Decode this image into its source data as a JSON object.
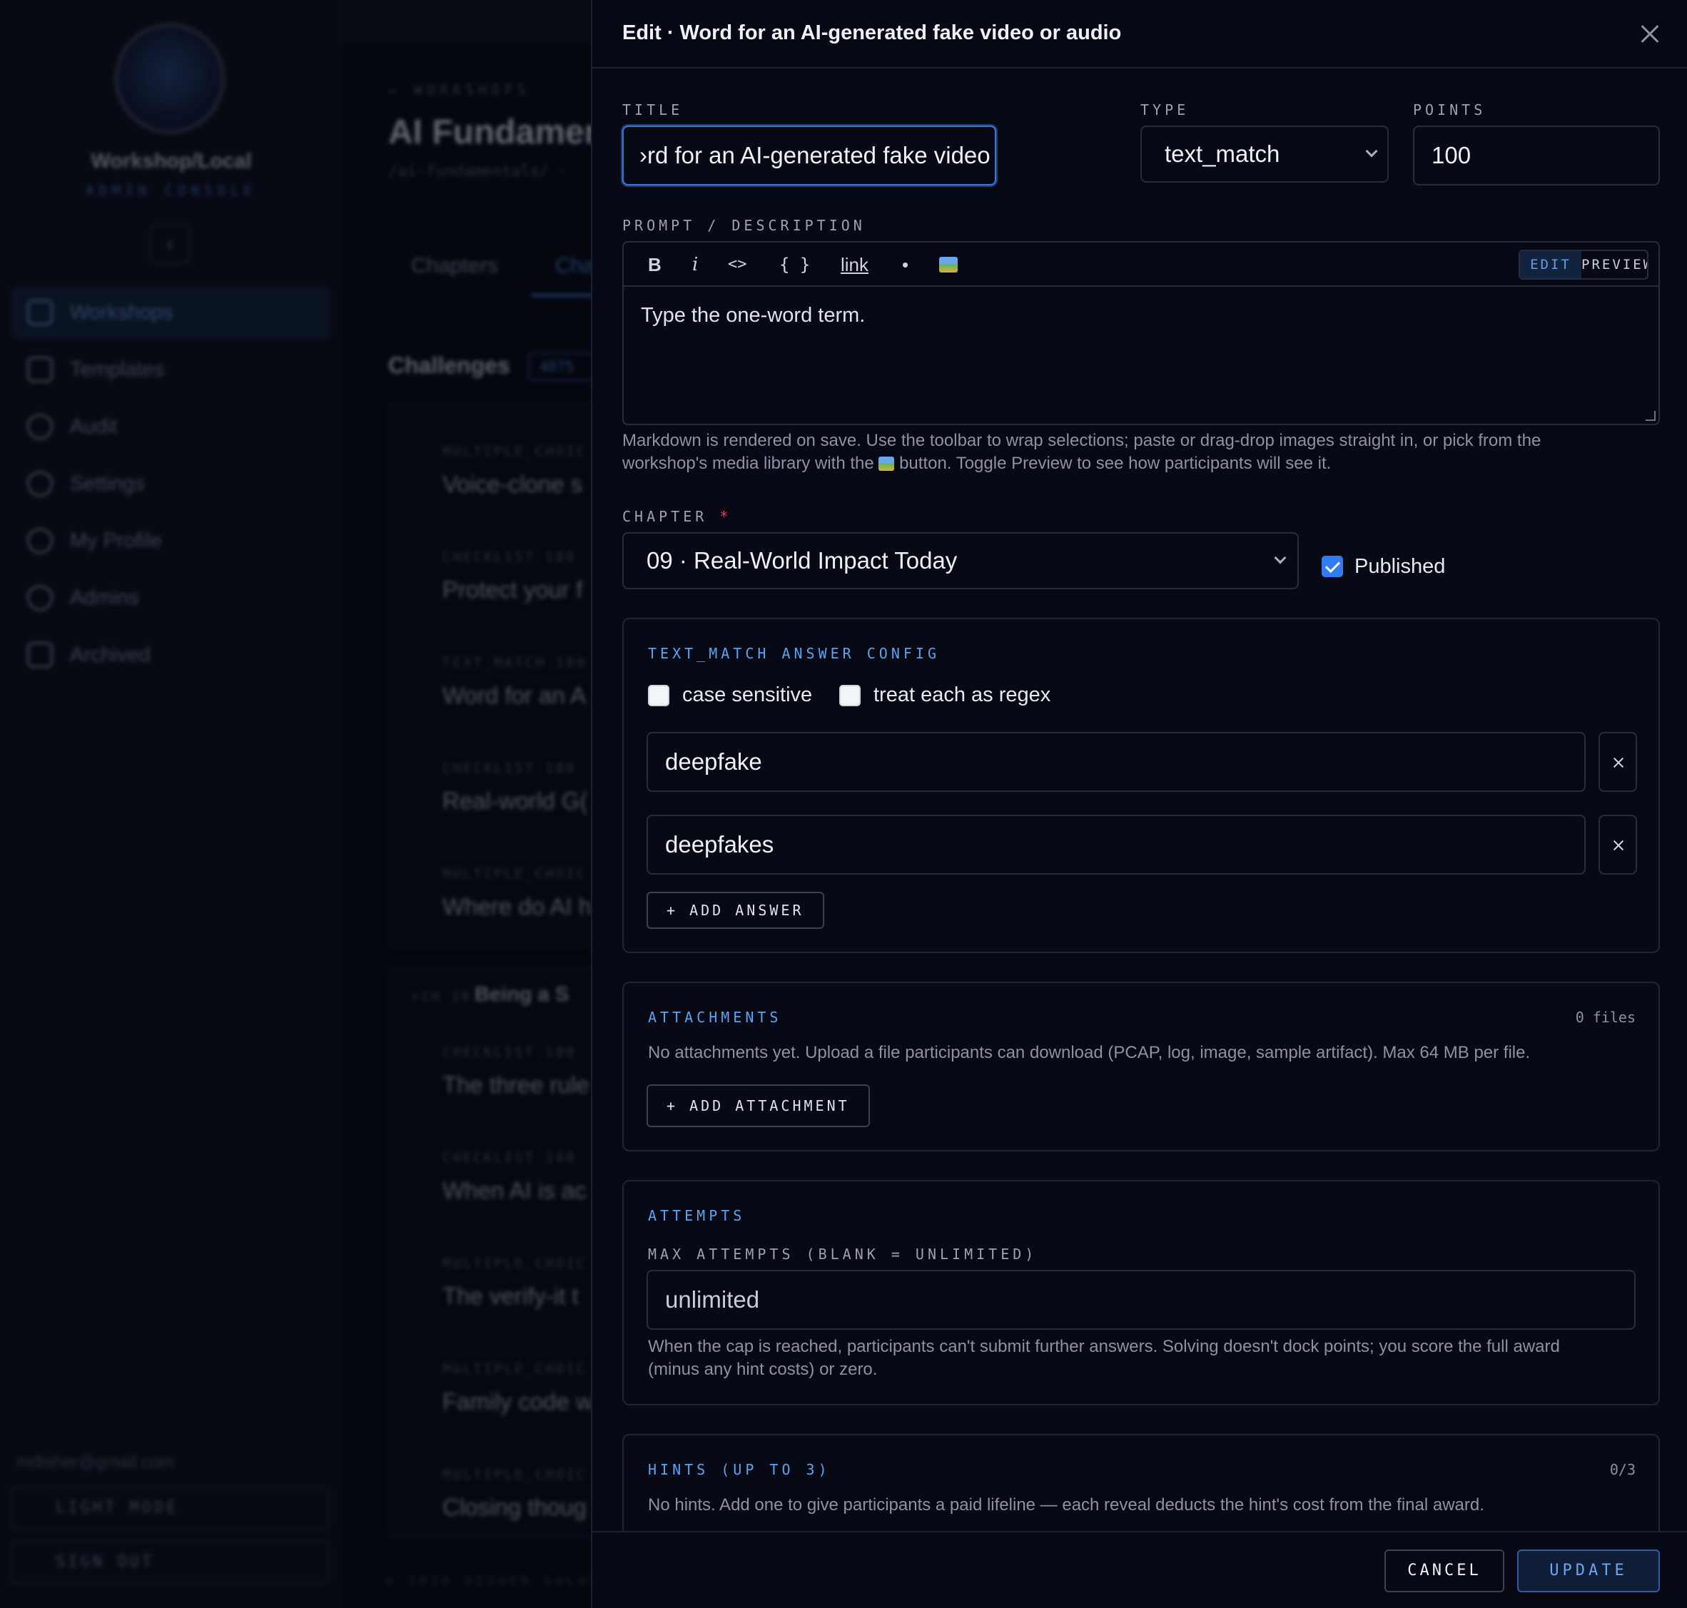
{
  "background": {
    "sidebar": {
      "brand": "Workshop/Local",
      "brand_sub": "ADMIN CONSOLE",
      "collapse_glyph": "‹",
      "nav": [
        {
          "label": "Workshops",
          "icon": "grid-icon",
          "active": true
        },
        {
          "label": "Templates",
          "icon": "layers-icon"
        },
        {
          "label": "Audit",
          "icon": "clock-icon"
        },
        {
          "label": "Settings",
          "icon": "gear-icon"
        },
        {
          "label": "My Profile",
          "icon": "gear-icon"
        },
        {
          "label": "Admins",
          "icon": "gear-icon"
        },
        {
          "label": "Archived",
          "icon": "archive-icon"
        }
      ],
      "user_email": "mdisher@gmail.com",
      "light_mode_label": "LIGHT MODE",
      "sign_out_label": "SIGN OUT"
    },
    "main": {
      "breadcrumb": "← WORKSHOPS",
      "title": "AI Fundamen",
      "path": "/ai-fundamentals/ ·",
      "tabs": [
        "Chapters",
        "Cha"
      ],
      "section_title": "Challenges",
      "section_count": "4075",
      "chapter_group": {
        "marker": "▾",
        "ch_label": "CH 10",
        "title": "Being a S"
      },
      "rows_group_1": [
        {
          "kind": "MULTIPLE_CHOIC",
          "points": "",
          "title": "Voice-clone s"
        },
        {
          "kind": "CHECKLIST",
          "points": "100",
          "title": "Protect your f"
        },
        {
          "kind": "TEXT_MATCH",
          "points": "100",
          "title": "Word for an A"
        },
        {
          "kind": "CHECKLIST",
          "points": "100",
          "title": "Real-world G("
        },
        {
          "kind": "MULTIPLE_CHOIC",
          "points": "",
          "title": "Where do AI h"
        }
      ],
      "rows_group_2": [
        {
          "kind": "CHECKLIST",
          "points": "100",
          "title": "The three rule"
        },
        {
          "kind": "CHECKLIST",
          "points": "100",
          "title": "When AI is ac"
        },
        {
          "kind": "MULTIPLE_CHOIC",
          "points": "",
          "title": "The verify-it t"
        },
        {
          "kind": "MULTIPLE_CHOIC",
          "points": "",
          "title": "Family code w"
        },
        {
          "kind": "MULTIPLE_CHOIC",
          "points": "",
          "title": "Closing thoug"
        }
      ],
      "footer": "© 2026 DISHER SOLUTIO"
    }
  },
  "modal": {
    "header_title": "Edit · Word for an AI-generated fake video or audio",
    "title_label": "TITLE",
    "title_value": "›rd for an AI-generated fake video or audio",
    "type_label": "TYPE",
    "type_value": "text_match",
    "points_label": "POINTS",
    "points_value": "100",
    "prompt_label": "PROMPT / DESCRIPTION",
    "toolbar": {
      "bold": "B",
      "italic": "i",
      "code": "<>",
      "code_block": "{ }",
      "link": "link",
      "bullet": "•"
    },
    "mode_edit": "EDIT",
    "mode_preview": "PREVIEW",
    "prompt_text": "Type the one-word term.",
    "prompt_help_1": "Markdown is rendered on save. Use the toolbar to wrap selections; paste or drag-drop images straight in, or pick from the",
    "prompt_help_2a": "workshop's media library with the",
    "prompt_help_2b": "button. Toggle Preview to see how participants will see it.",
    "chapter_label": "CHAPTER",
    "chapter_required": "*",
    "chapter_value": "09 · Real-World Impact Today",
    "published_label": "Published",
    "published_checked": true,
    "answer_config": {
      "title": "TEXT_MATCH ANSWER CONFIG",
      "case_sensitive_label": "case sensitive",
      "case_sensitive": false,
      "regex_label": "treat each as regex",
      "regex": false,
      "answers": [
        "deepfake",
        "deepfakes"
      ],
      "add_answer_label": "+ ADD ANSWER"
    },
    "attachments": {
      "title": "ATTACHMENTS",
      "count": "0 files",
      "empty_text": "No attachments yet. Upload a file participants can download (PCAP, log, image, sample artifact). Max 64 MB per file.",
      "add_label": "+ ADD ATTACHMENT"
    },
    "attempts": {
      "title": "ATTEMPTS",
      "max_label": "MAX ATTEMPTS (BLANK = UNLIMITED)",
      "max_placeholder": "unlimited",
      "help_1": "When the cap is reached, participants can't submit further answers. Solving doesn't dock points; you score the full award",
      "help_2": "(minus any hint costs) or zero."
    },
    "hints": {
      "title": "HINTS (UP TO 3)",
      "count": "0/3",
      "empty_text": "No hints. Add one to give participants a paid lifeline — each reveal deducts the hint's cost from the final award."
    },
    "cancel_label": "CANCEL",
    "update_label": "UPDATE"
  }
}
